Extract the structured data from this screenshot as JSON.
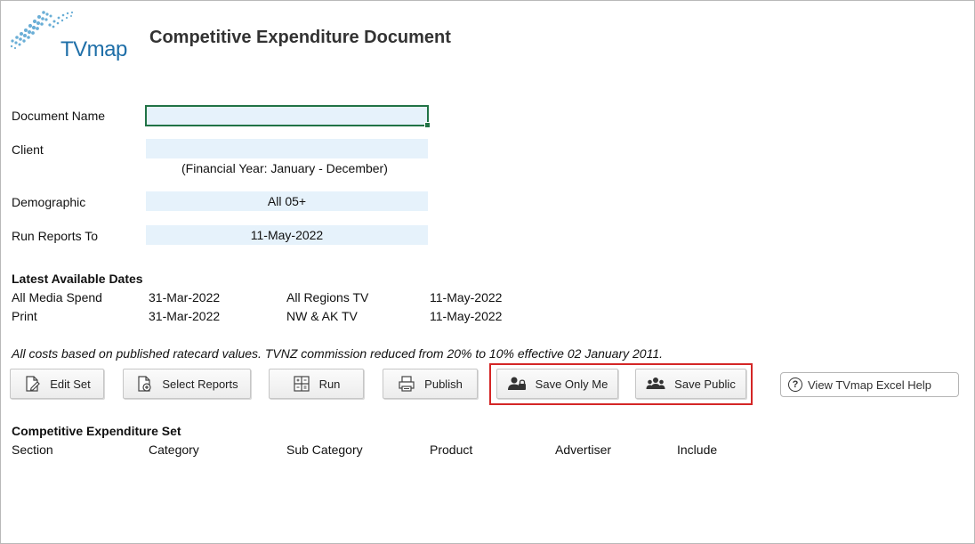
{
  "logo": {
    "text": "TVmap"
  },
  "page_title": "Competitive Expenditure Document",
  "form": {
    "document_name": {
      "label": "Document Name",
      "value": ""
    },
    "client": {
      "label": "Client",
      "value": "",
      "note": "(Financial Year: January - December)"
    },
    "demographic": {
      "label": "Demographic",
      "value": "All 05+"
    },
    "run_reports_to": {
      "label": "Run Reports To",
      "value": "11-May-2022"
    }
  },
  "latest_dates": {
    "heading": "Latest Available Dates",
    "rows": [
      {
        "label1": "All Media Spend",
        "date1": "31-Mar-2022",
        "label2": "All Regions TV",
        "date2": "11-May-2022"
      },
      {
        "label1": "Print",
        "date1": "31-Mar-2022",
        "label2": "NW & AK TV",
        "date2": "11-May-2022"
      }
    ]
  },
  "note": "All costs based on published ratecard values. TVNZ commission reduced from 20% to 10% effective 02 January 2011.",
  "toolbar": {
    "edit_set": "Edit Set",
    "select_reports": "Select Reports",
    "run": "Run",
    "publish": "Publish",
    "save_only_me": "Save Only Me",
    "save_public": "Save Public",
    "help": "View TVmap Excel Help"
  },
  "set": {
    "heading": "Competitive Expenditure Set",
    "columns": [
      "Section",
      "Category",
      "Sub Category",
      "Product",
      "Advertiser",
      "Include"
    ]
  },
  "colors": {
    "accent": "#217346",
    "highlight": "#d42626",
    "field_bg": "#e6f2fb"
  }
}
